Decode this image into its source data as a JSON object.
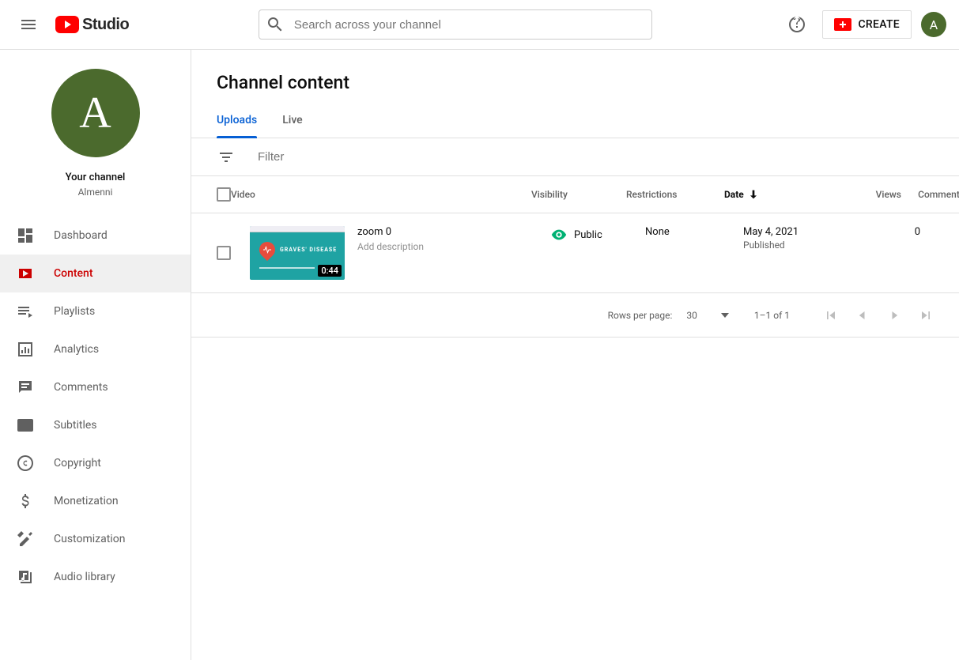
{
  "header": {
    "logo_text": "Studio",
    "search_placeholder": "Search across your channel",
    "create_label": "CREATE",
    "avatar_initial": "A"
  },
  "sidebar": {
    "avatar_initial": "A",
    "your_channel_label": "Your channel",
    "channel_name": "Almenni",
    "items": [
      {
        "id": "dashboard",
        "label": "Dashboard"
      },
      {
        "id": "content",
        "label": "Content"
      },
      {
        "id": "playlists",
        "label": "Playlists"
      },
      {
        "id": "analytics",
        "label": "Analytics"
      },
      {
        "id": "comments",
        "label": "Comments"
      },
      {
        "id": "subtitles",
        "label": "Subtitles"
      },
      {
        "id": "copyright",
        "label": "Copyright"
      },
      {
        "id": "monetization",
        "label": "Monetization"
      },
      {
        "id": "customization",
        "label": "Customization"
      },
      {
        "id": "audio",
        "label": "Audio library"
      }
    ],
    "active_id": "content"
  },
  "main": {
    "page_title": "Channel content",
    "tabs": [
      {
        "id": "uploads",
        "label": "Uploads"
      },
      {
        "id": "live",
        "label": "Live"
      }
    ],
    "active_tab": "uploads",
    "filter_placeholder": "Filter",
    "columns": {
      "video": "Video",
      "visibility": "Visibility",
      "restrictions": "Restrictions",
      "date": "Date",
      "views": "Views",
      "comments": "Comments"
    },
    "rows": [
      {
        "title": "zoom 0",
        "description_placeholder": "Add description",
        "duration": "0:44",
        "thumb_text": "GRAVES' DISEASE",
        "visibility": "Public",
        "restrictions": "None",
        "date": "May 4, 2021",
        "date_status": "Published",
        "views": "0"
      }
    ],
    "pagination": {
      "rows_per_page_label": "Rows per page:",
      "rows_per_page_value": "30",
      "range": "1–1 of 1"
    }
  }
}
